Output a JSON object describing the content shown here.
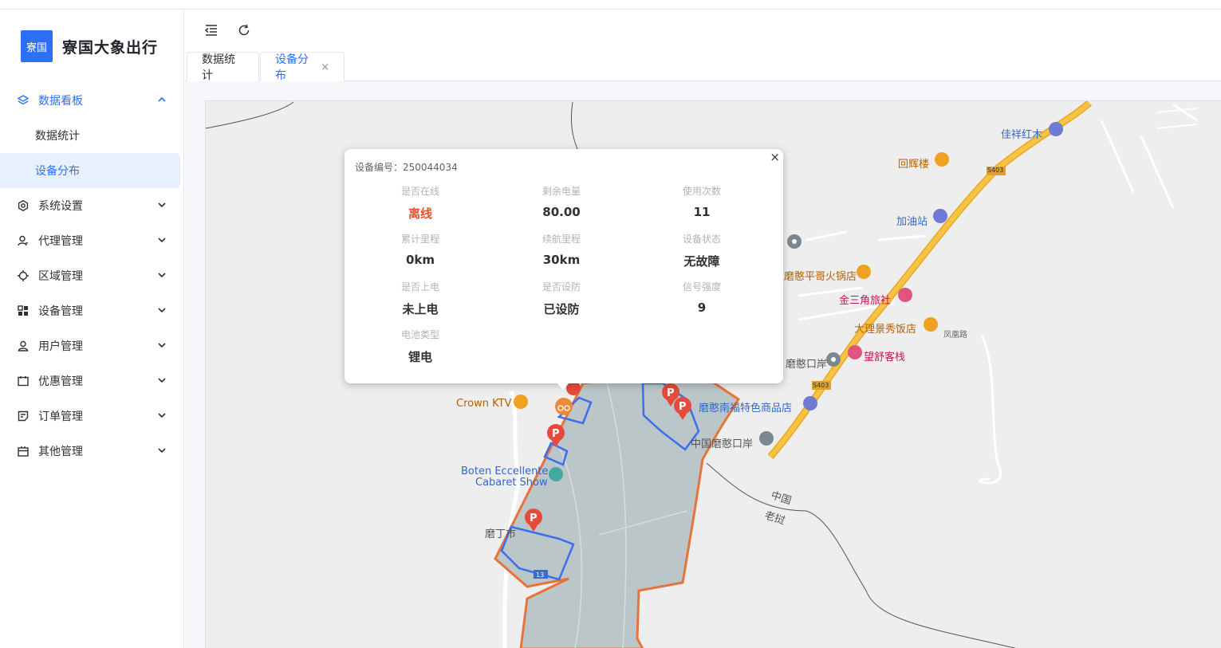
{
  "app": {
    "logo_badge": "寮国",
    "title": "寮国大象出行"
  },
  "sidebar": {
    "items": [
      {
        "label": "数据看板",
        "icon": "layers-icon",
        "expanded": true,
        "children": [
          {
            "label": "数据统计"
          },
          {
            "label": "设备分布",
            "active": true
          }
        ]
      },
      {
        "label": "系统设置",
        "icon": "gear-icon"
      },
      {
        "label": "代理管理",
        "icon": "user-manage-icon"
      },
      {
        "label": "区域管理",
        "icon": "crosshair-icon"
      },
      {
        "label": "设备管理",
        "icon": "grid-icon"
      },
      {
        "label": "用户管理",
        "icon": "user-icon"
      },
      {
        "label": "优惠管理",
        "icon": "ticket-icon"
      },
      {
        "label": "订单管理",
        "icon": "order-icon"
      },
      {
        "label": "其他管理",
        "icon": "box-icon"
      }
    ]
  },
  "toolbar": {
    "collapse_icon": "indent-icon",
    "refresh_icon": "refresh-icon"
  },
  "tabs": [
    {
      "label": "数据统计"
    },
    {
      "label": "设备分布",
      "active": true,
      "close": "×"
    }
  ],
  "popup": {
    "device_label": "设备编号：250044034",
    "close": "×",
    "fields": [
      {
        "label": "是否在线",
        "value": "离线",
        "color": "#e8522c"
      },
      {
        "label": "剩余电量",
        "value": "80.00"
      },
      {
        "label": "使用次数",
        "value": "11"
      },
      {
        "label": "累计里程",
        "value": "0km"
      },
      {
        "label": "续航里程",
        "value": "30km"
      },
      {
        "label": "设备状态",
        "value": "无故障"
      },
      {
        "label": "是否上电",
        "value": "未上电"
      },
      {
        "label": "是否设防",
        "value": "已设防"
      },
      {
        "label": "信号强度",
        "value": "9"
      },
      {
        "label": "电池类型",
        "value": "锂电"
      }
    ]
  },
  "map": {
    "pois": [
      {
        "text": "佳祥红木",
        "style": "blue"
      },
      {
        "text": "回辉楼",
        "style": "orange"
      },
      {
        "text": "S403",
        "style": "small"
      },
      {
        "text": "加油站",
        "style": "blue"
      },
      {
        "text": "磨憨平哥火锅店",
        "style": "orange"
      },
      {
        "text": "金三角旅社",
        "style": "pink"
      },
      {
        "text": "大理景秀饭店",
        "style": "orange"
      },
      {
        "text": "凤凰路",
        "style": "small"
      },
      {
        "text": "磨憨口岸",
        "style": "gray"
      },
      {
        "text": "望舒客栈",
        "style": "pink"
      },
      {
        "text": "S403",
        "style": "small"
      },
      {
        "text": "磨憨南福特色商品店",
        "style": "blue"
      },
      {
        "text": "中国磨憨口岸",
        "style": "gray"
      },
      {
        "text": "Crown KTV",
        "style": "orange"
      },
      {
        "text": "Boten Eccellente",
        "style": "blue"
      },
      {
        "text": "Cabaret Show",
        "style": "blue"
      },
      {
        "text": "磨丁市",
        "style": "gray"
      },
      {
        "text": "中国",
        "style": "gray"
      },
      {
        "text": "老挝",
        "style": "gray"
      },
      {
        "text": "13",
        "style": "small"
      }
    ],
    "parking_label": "P",
    "colors": {
      "zone_fill": "#b7c3c6",
      "zone_border": "#e8733a",
      "parking_border": "#3b6ef0",
      "marker": "#e54b3c",
      "road": "#f6c344"
    }
  }
}
